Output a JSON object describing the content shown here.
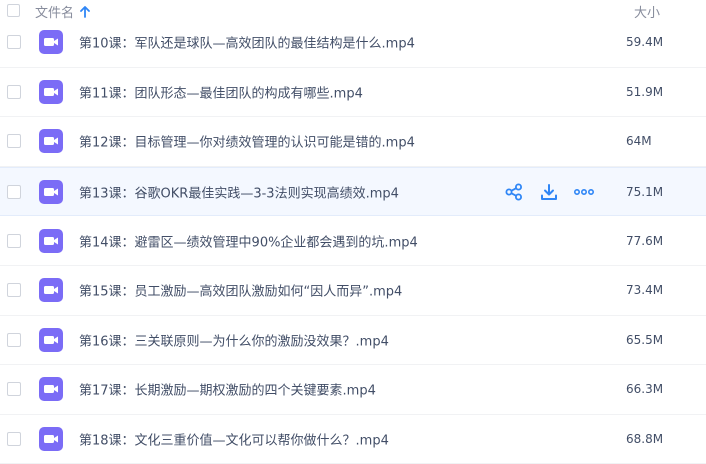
{
  "header": {
    "name_label": "文件名",
    "size_label": "大小"
  },
  "colors": {
    "accent": "#2f86f6",
    "video_icon": "#7b6cf6"
  },
  "icons": {
    "sort": "arrow-up-icon",
    "file": "video-file-icon",
    "share": "share-icon",
    "download": "download-icon",
    "more": "more-icon"
  },
  "files": [
    {
      "name": "第10课：军队还是球队—高效团队的最佳结构是什么.mp4",
      "size": "59.4M"
    },
    {
      "name": "第11课：团队形态—最佳团队的构成有哪些.mp4",
      "size": "51.9M"
    },
    {
      "name": "第12课：目标管理—你对绩效管理的认识可能是错的.mp4",
      "size": "64M"
    },
    {
      "name": "第13课：谷歌OKR最佳实践—3-3法则实现高绩效.mp4",
      "size": "75.1M"
    },
    {
      "name": "第14课：避雷区—绩效管理中90%企业都会遇到的坑.mp4",
      "size": "77.6M"
    },
    {
      "name": "第15课：员工激励—高效团队激励如何“因人而异”.mp4",
      "size": "73.4M"
    },
    {
      "name": "第16课：三关联原则—为什么你的激励没效果？.mp4",
      "size": "65.5M"
    },
    {
      "name": "第17课：长期激励—期权激励的四个关键要素.mp4",
      "size": "66.3M"
    },
    {
      "name": "第18课：文化三重价值—文化可以帮你做什么？.mp4",
      "size": "68.8M"
    }
  ]
}
